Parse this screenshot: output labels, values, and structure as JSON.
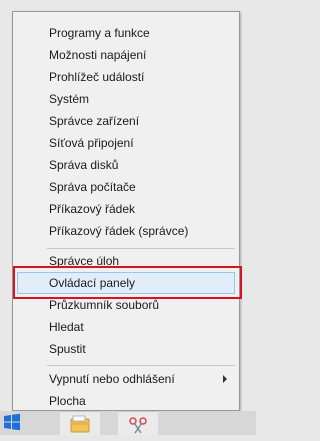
{
  "menu": {
    "items": [
      {
        "label": "Programy a funkce"
      },
      {
        "label": "Možnosti napájení"
      },
      {
        "label": "Prohlížeč událostí"
      },
      {
        "label": "Systém"
      },
      {
        "label": "Správce zařízení"
      },
      {
        "label": "Síťová připojení"
      },
      {
        "label": "Správa disků"
      },
      {
        "label": "Správa počítače"
      },
      {
        "label": "Příkazový řádek"
      },
      {
        "label": "Příkazový řádek (správce)"
      },
      {
        "label": "Správce úloh"
      },
      {
        "label": "Ovládací panely",
        "highlighted": true
      },
      {
        "label": "Průzkumník souborů"
      },
      {
        "label": "Hledat"
      },
      {
        "label": "Spustit"
      },
      {
        "label": "Vypnutí nebo odhlášení",
        "has_submenu": true
      },
      {
        "label": "Plocha"
      }
    ]
  },
  "annotation": {
    "color": "#d8121e"
  },
  "taskbar": {
    "icons": [
      "windows-start-icon",
      "file-explorer-icon",
      "snipping-tool-icon"
    ],
    "accent": "#1e6fd9"
  }
}
